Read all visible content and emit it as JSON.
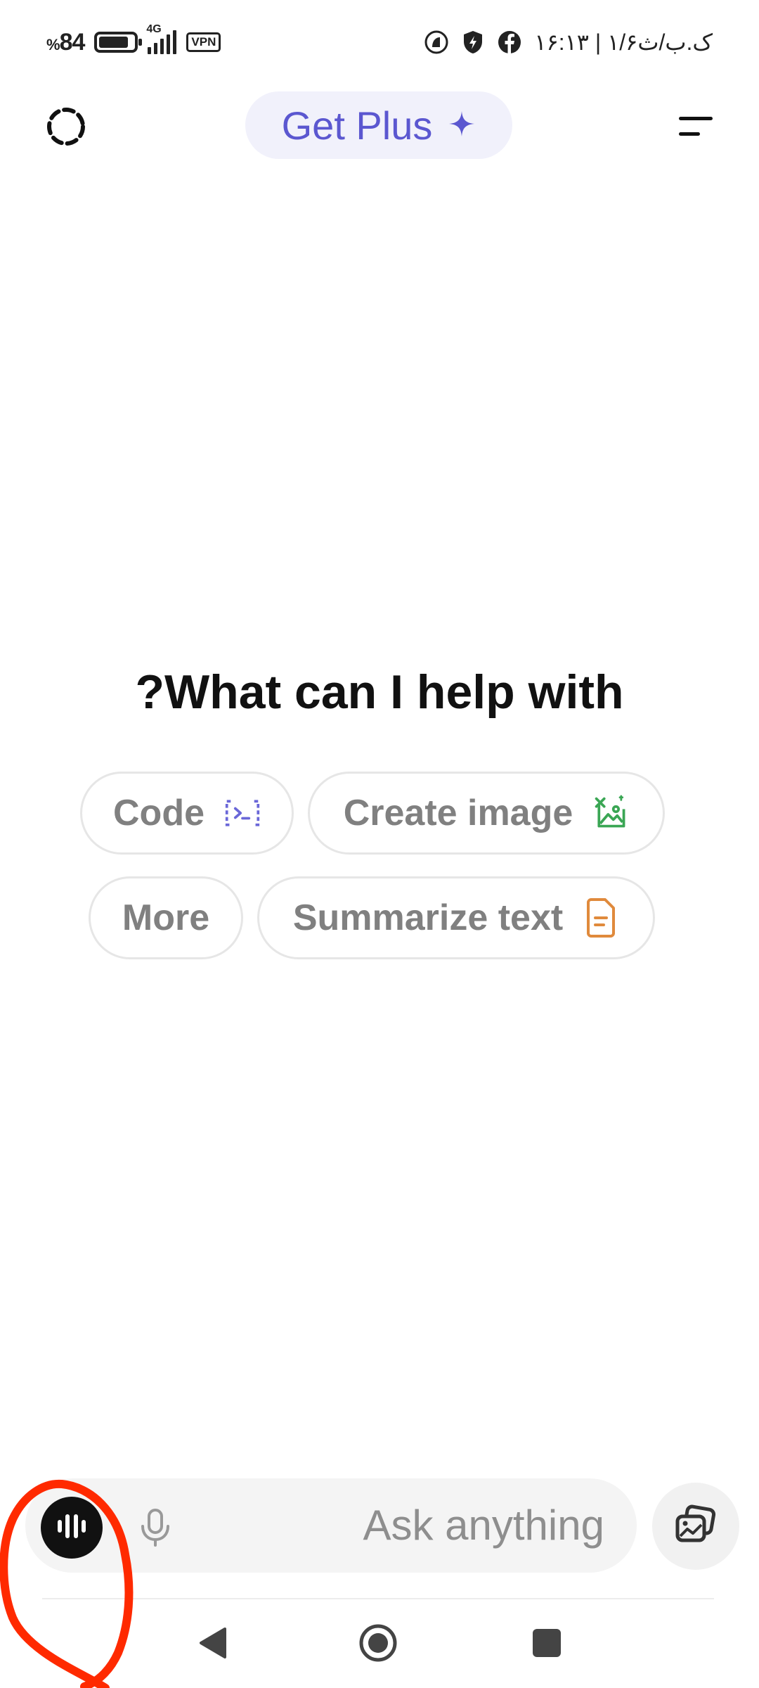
{
  "status_bar": {
    "battery_percent_sign": "%",
    "battery_level": "84",
    "battery_fill_fraction": 0.84,
    "network_type": "4G",
    "vpn_label": "VPN",
    "date_time": "۱۶:۱۳ | ۱/۶ک.ب/ث"
  },
  "header": {
    "get_plus_label": "Get Plus",
    "colors": {
      "accent": "#5b57d0",
      "pill_bg": "#f1f1fb"
    }
  },
  "hero": {
    "title": "?What can I help with"
  },
  "chips": [
    {
      "label": "Code",
      "icon": "code-icon",
      "color": "#6a67d8"
    },
    {
      "label": "Create image",
      "icon": "image-icon",
      "color": "#3aa654"
    },
    {
      "label": "More",
      "icon": "",
      "color": ""
    },
    {
      "label": "Summarize text",
      "icon": "document-icon",
      "color": "#e08a3c"
    }
  ],
  "composer": {
    "placeholder": "Ask anything",
    "voice_icon": "voice-mode-icon",
    "mic_icon": "microphone-icon",
    "photo_icon": "photo-library-icon"
  },
  "nav": {
    "back_icon": "back-triangle-icon",
    "home_icon": "home-circle-icon",
    "recent_icon": "recent-apps-square-icon"
  },
  "annotation": {
    "color": "#ff2a00"
  }
}
